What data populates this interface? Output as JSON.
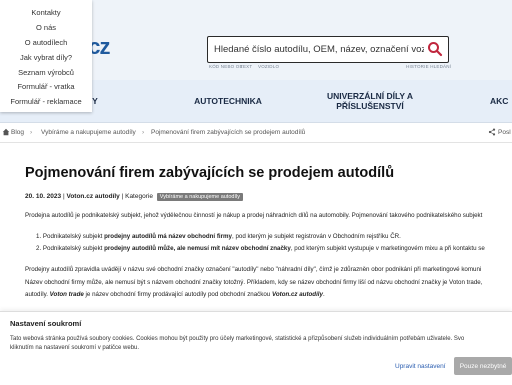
{
  "header": {
    "logo": "l.cz",
    "search_placeholder": "Hledané číslo autodílu, OEM, název, označení vozidla...",
    "hints": [
      "KÓD NEBO OE",
      "TEXT",
      "VOZIDLO",
      "HISTORIE HLEDÁNÍ"
    ]
  },
  "dropdown": {
    "items": [
      "Kontakty",
      "O nás",
      "O autodílech",
      "Jak vybrat díly?",
      "Seznam výrobců",
      "Formulář - vratka",
      "Formulář - reklamace"
    ]
  },
  "nav": {
    "items": [
      "Y",
      "AUTOTECHNIKA",
      "UNIVERZÁLNÍ DÍLY A PŘÍSLUŠENSTVÍ",
      "AKC"
    ]
  },
  "breadcrumb": {
    "home": "Blog",
    "category": "Vybíráme a nakupujeme autodíly",
    "current": "Pojmenování firem zabývajících se prodejem autodílů",
    "action": "Posl"
  },
  "article": {
    "title": "Pojmenování firem zabývajících se prodejem autodílů",
    "date": "20. 10. 2023",
    "author": "Voton.cz autodíly",
    "category_label": "Kategorie",
    "category_badge": "Vybíráme a nakupujeme autodíly",
    "intro": "Prodejna autodílů je podnikatelský subjekt, jehož výdělečnou činností je nákup a prodej náhradních dílů na automobily. Pojmenování takového podnikatelského subjekt",
    "list": [
      {
        "pre": "1. Podnikatelský subjekt ",
        "bold": "prodejny autodílů má název obchodní firmy",
        "post": ", pod kterým je subjekt registrován v Obchodním rejstříku ČR."
      },
      {
        "pre": "2. Podnikatelský subjekt ",
        "bold": "prodejny autodílů může, ale nemusí mít název obchodní značky",
        "post": ", pod kterým subjekt vystupuje v marketingovém mixu a při kontaktu se"
      }
    ],
    "p2_line1": "Prodejny autodílů zpravidla uvádějí v názvu své obchodní značky označení \"autodíly\" nebo \"náhradní díly\", čímž je zdůrazněn obor podnikání při marketingové komuni",
    "p2_line2": "Název obchodní firmy může, ale nemusí být s názvem obchodní značky totožný. Příkladem, kdy se název obchodní firmy liší od názvu obchodní značky je Voton trade,",
    "p2_line3_a": "autodíly. ",
    "p2_line3_b": "Voton trade",
    "p2_line3_c": " je název obchodní firmy prodávající autodíly pod obchodní značkou ",
    "p2_line3_d": "Voton.cz autodíly",
    "p2_line3_e": "."
  },
  "consent": {
    "title": "Nastavení soukromí",
    "text1": "Tato webová stránka používá soubory cookies. Cookies mohou být použity pro účely marketingové, statistické a přizpůsobení služeb individuálním potřebám uživatele. Svo",
    "text2": "kliknutím na nastavení soukromí v patičce webu.",
    "settings_link": "Upravit nastavení",
    "accept_button": "Pouze nezbytné"
  }
}
